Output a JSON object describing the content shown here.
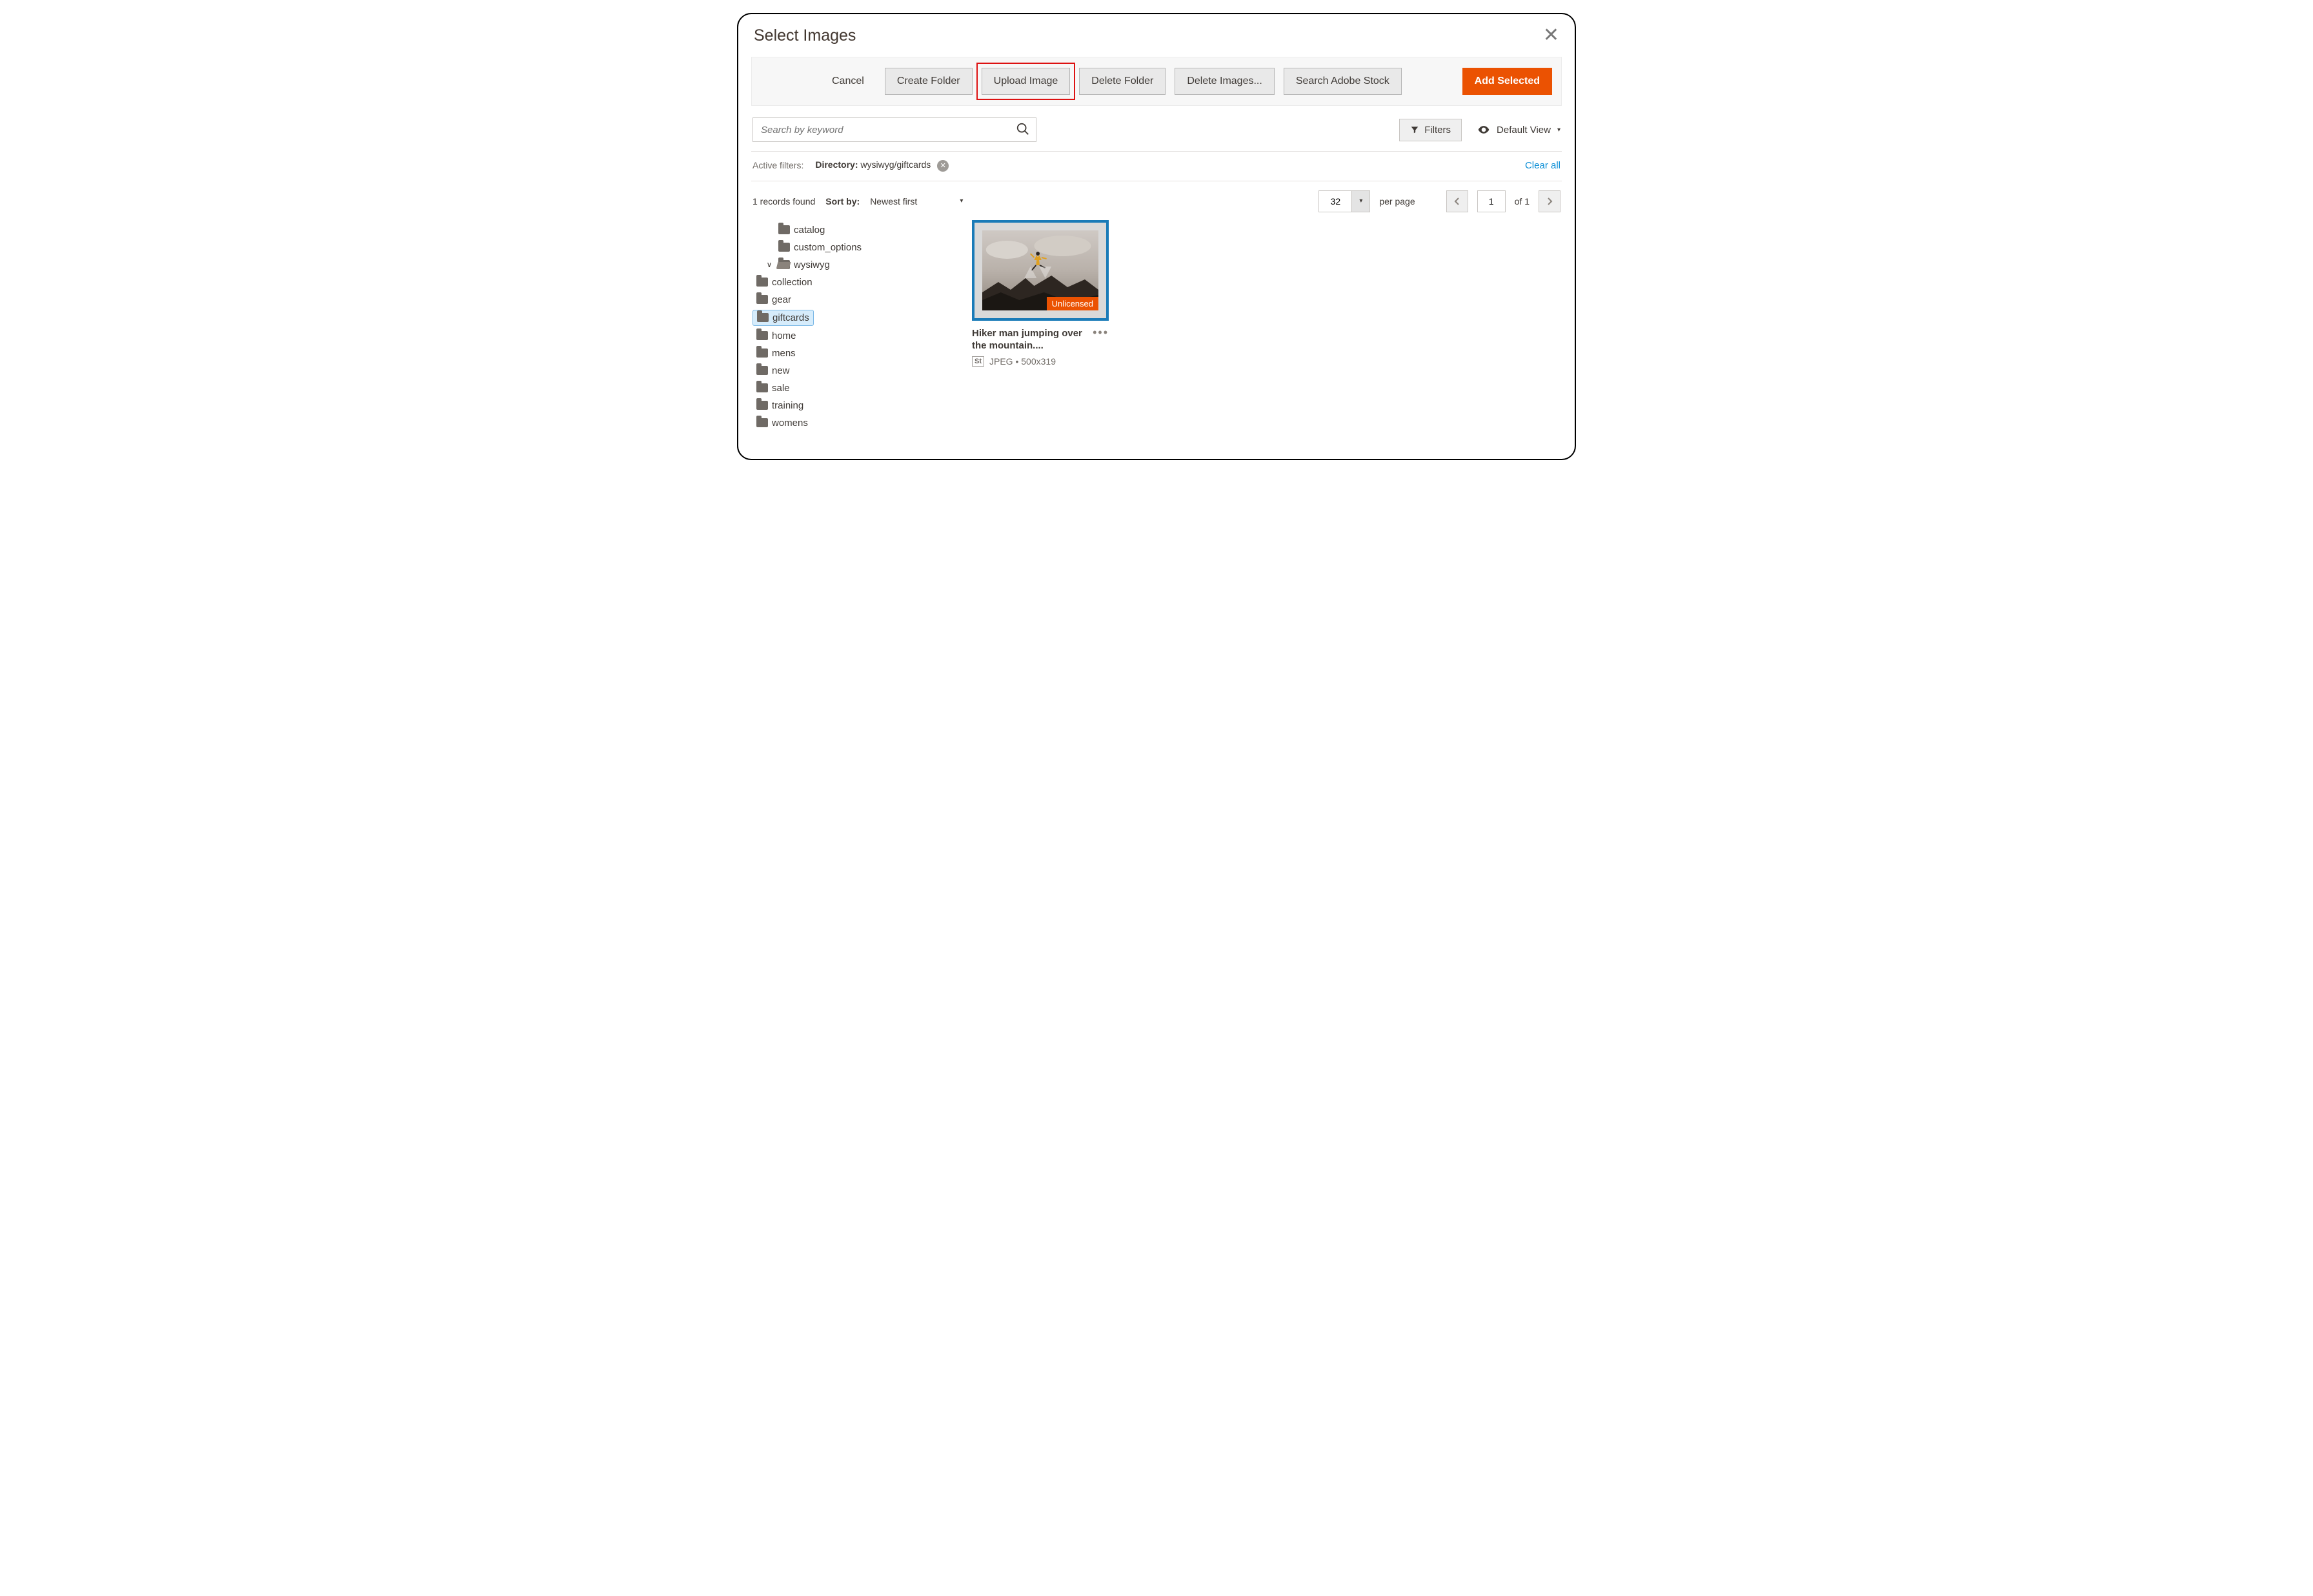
{
  "modal": {
    "title": "Select Images"
  },
  "toolbar": {
    "cancel": "Cancel",
    "create_folder": "Create Folder",
    "upload_image": "Upload Image",
    "delete_folder": "Delete Folder",
    "delete_images": "Delete Images...",
    "search_stock": "Search Adobe Stock",
    "add_selected": "Add Selected"
  },
  "search": {
    "placeholder": "Search by keyword"
  },
  "controls": {
    "filters": "Filters",
    "default_view": "Default View"
  },
  "active_filters": {
    "label": "Active filters:",
    "directory_label": "Directory:",
    "directory_value": "wysiwyg/giftcards",
    "clear_all": "Clear all"
  },
  "meta": {
    "records_found": "1 records found",
    "sort_by_label": "Sort by:",
    "sort_by_value": "Newest first"
  },
  "pager": {
    "per_page_value": "32",
    "per_page_label": "per page",
    "page_value": "1",
    "of_label": "of 1"
  },
  "tree": {
    "root": [
      {
        "name": "catalog"
      },
      {
        "name": "custom_options"
      },
      {
        "name": "wysiwyg",
        "open": true,
        "children": [
          {
            "name": "collection"
          },
          {
            "name": "gear"
          },
          {
            "name": "giftcards",
            "selected": true
          },
          {
            "name": "home"
          },
          {
            "name": "mens"
          },
          {
            "name": "new"
          },
          {
            "name": "sale"
          },
          {
            "name": "training"
          },
          {
            "name": "womens"
          }
        ]
      }
    ]
  },
  "gallery": {
    "items": [
      {
        "title": "Hiker man jumping over the mountain....",
        "badge": "Unlicensed",
        "stock_badge": "St",
        "format": "JPEG",
        "dimensions": "500x319"
      }
    ]
  }
}
